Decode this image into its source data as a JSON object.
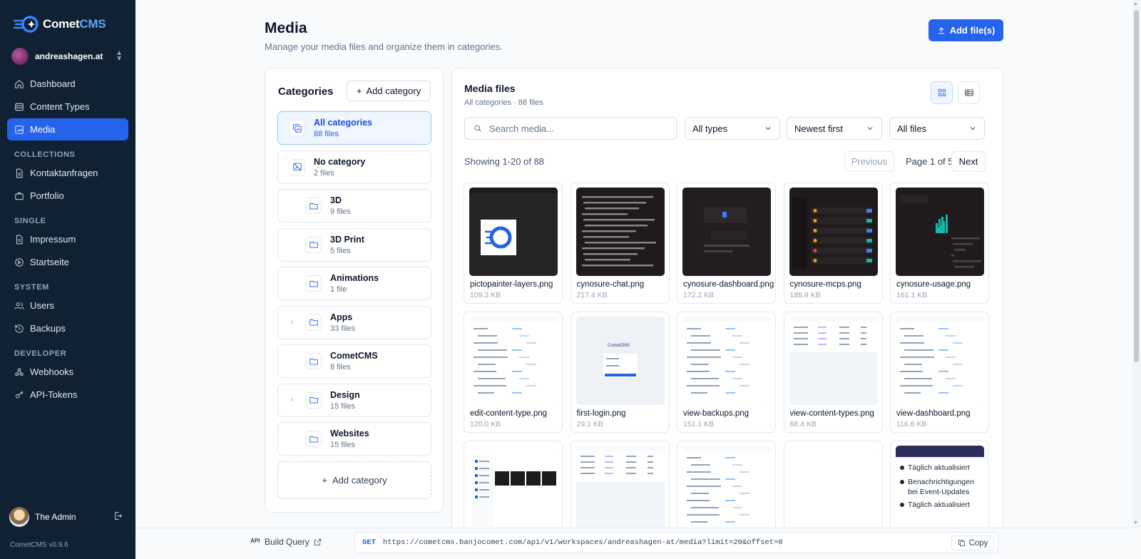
{
  "app": {
    "name_part1": "Comet",
    "name_part2": "CMS",
    "version": "CometCMS v0.9.6"
  },
  "workspace": {
    "name": "andreashagen.at"
  },
  "nav": {
    "main": [
      {
        "label": "Dashboard",
        "icon": "home-icon"
      },
      {
        "label": "Content Types",
        "icon": "list-icon"
      },
      {
        "label": "Media",
        "icon": "image-icon",
        "active": true
      }
    ],
    "sections": [
      {
        "title": "COLLECTIONS",
        "items": [
          {
            "label": "Kontaktanfragen",
            "icon": "file-icon"
          },
          {
            "label": "Portfolio",
            "icon": "briefcase-icon"
          }
        ]
      },
      {
        "title": "SINGLE",
        "items": [
          {
            "label": "Impressum",
            "icon": "file-icon"
          },
          {
            "label": "Startseite",
            "icon": "circle-play-icon"
          }
        ]
      },
      {
        "title": "SYSTEM",
        "items": [
          {
            "label": "Users",
            "icon": "users-icon"
          },
          {
            "label": "Backups",
            "icon": "history-icon"
          }
        ]
      },
      {
        "title": "DEVELOPER",
        "items": [
          {
            "label": "Webhooks",
            "icon": "webhook-icon"
          },
          {
            "label": "API-Tokens",
            "icon": "key-icon"
          }
        ]
      }
    ]
  },
  "user": {
    "name": "The Admin"
  },
  "page": {
    "title": "Media",
    "subtitle": "Manage your media files and organize them in categories.",
    "add_files_label": "Add file(s)"
  },
  "categories": {
    "heading": "Categories",
    "add_label": "Add category",
    "items": [
      {
        "name": "All categories",
        "count": "88 files",
        "active": true,
        "level": "top",
        "icon": "gallery-icon"
      },
      {
        "name": "No category",
        "count": "2 files",
        "level": "top",
        "icon": "no-image-icon"
      },
      {
        "name": "3D",
        "count": "9 files",
        "level": "sub",
        "icon": "folder-icon"
      },
      {
        "name": "3D Print",
        "count": "5 files",
        "level": "sub",
        "icon": "folder-icon"
      },
      {
        "name": "Animations",
        "count": "1 file",
        "level": "sub",
        "icon": "folder-icon"
      },
      {
        "name": "Apps",
        "count": "33 files",
        "level": "sub",
        "icon": "folder-icon",
        "expandable": true
      },
      {
        "name": "CometCMS",
        "count": "8 files",
        "level": "sub",
        "icon": "folder-icon"
      },
      {
        "name": "Design",
        "count": "15 files",
        "level": "sub",
        "icon": "folder-icon",
        "expandable": true
      },
      {
        "name": "Websites",
        "count": "15 files",
        "level": "sub",
        "icon": "folder-icon"
      }
    ]
  },
  "media": {
    "title": "Media files",
    "subtitle": "All categories · 88 files",
    "search_placeholder": "Search media...",
    "filter_type": "All types",
    "filter_sort": "Newest first",
    "filter_files": "All files",
    "showing": "Showing 1-20 of 88",
    "prev_label": "Previous",
    "page_label": "Page 1 of 5",
    "next_label": "Next",
    "files": [
      {
        "name": "pictopainter-layers.png",
        "size": "109.3 KB",
        "thumb": "logo"
      },
      {
        "name": "cynosure-chat.png",
        "size": "217.4 KB",
        "thumb": "dark-text"
      },
      {
        "name": "cynosure-dashboard.png",
        "size": "172.2 KB",
        "thumb": "dark-panels"
      },
      {
        "name": "cynosure-mcps.png",
        "size": "188.9 KB",
        "thumb": "dark-list"
      },
      {
        "name": "cynosure-usage.png",
        "size": "161.1 KB",
        "thumb": "dark-chart"
      },
      {
        "name": "edit-content-type.png",
        "size": "120.0 KB",
        "thumb": "light-form"
      },
      {
        "name": "first-login.png",
        "size": "29.1 KB",
        "thumb": "light-login"
      },
      {
        "name": "view-backups.png",
        "size": "151.1 KB",
        "thumb": "light-form"
      },
      {
        "name": "view-content-types.png",
        "size": "68.4 KB",
        "thumb": "light-table"
      },
      {
        "name": "view-dashboard.png",
        "size": "116.6 KB",
        "thumb": "light-form"
      },
      {
        "name": "",
        "size": "",
        "thumb": "light-media"
      },
      {
        "name": "",
        "size": "",
        "thumb": "light-table"
      },
      {
        "name": "",
        "size": "",
        "thumb": "light-form"
      },
      {
        "name": "",
        "size": "",
        "thumb": "blank"
      },
      {
        "name": "",
        "size": "",
        "thumb": "bullets",
        "bullets": [
          "Täglich aktualisiert",
          "Benachrichtigungen bei Event-Updates",
          "Täglich aktualisiert"
        ]
      }
    ]
  },
  "footer": {
    "api_badge": "API",
    "build_query_label": "Build Query",
    "method": "GET",
    "url": "https://cometcms.banjocomet.com/api/v1/workspaces/andreashagen-at/media?limit=20&offset=0",
    "copy_label": "Copy"
  },
  "colors": {
    "sidebar_bg": "#0f2133",
    "accent": "#2563eb",
    "page_bg": "#f8fafc"
  }
}
